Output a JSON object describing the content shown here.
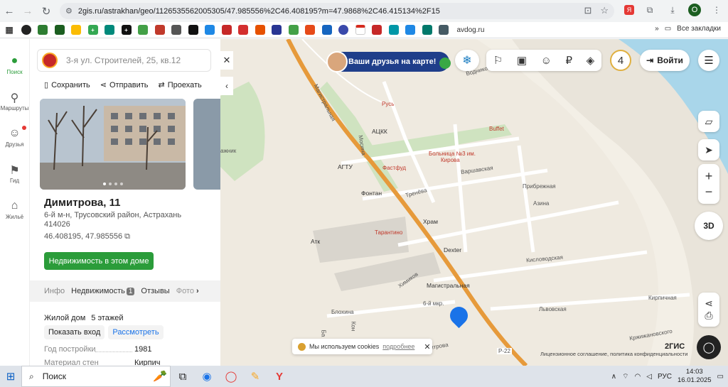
{
  "browser": {
    "url": "2gis.ru/astrakhan/geo/1126535562005305/47.985556%2C46.408195?m=47.9868%2C46.415134%2F15",
    "bookmark_avdog": "avdog.ru",
    "bookmark_all": "Все закладки",
    "profile_letter": "O"
  },
  "rail": {
    "search": "Поиск",
    "routes": "Маршруты",
    "friends": "Друзья",
    "guide": "Гид",
    "housing": "Жильё"
  },
  "panel": {
    "search_placeholder": "3-я ул. Строителей, 25, кв.12",
    "save": "Сохранить",
    "share": "Отправить",
    "route": "Проехать",
    "title": "Димитрова, 11",
    "address_line1": "6-й м-н, Трусовский район, Астрахань",
    "address_line2": "414026",
    "coordinates": "46.408195, 47.985556",
    "realty_button": "Недвижимость в этом доме",
    "tabs": {
      "info": "Инфо",
      "realty": "Недвижимость",
      "realty_count": "1",
      "reviews": "Отзывы",
      "photos": "Фото"
    },
    "building_type": "Жилой дом",
    "floors": "5 этажей",
    "show_entrance": "Показать вход",
    "view": "Рассмотреть",
    "year_label": "Год постройки",
    "year_value": "1981",
    "material_label": "Материал стен",
    "material_value": "Кирпич"
  },
  "map": {
    "promo_text": "Ваши друзья на карте!",
    "friends_count": "4",
    "login": "Войти",
    "zoom_in": "+",
    "zoom_out": "−",
    "btn_3d": "3D",
    "cookie_text": "Мы используем cookies",
    "cookie_link": "подробнее",
    "brand": "2ГИС",
    "license": "Лицензионное соглашение, политика конфиденциальности",
    "labels": {
      "magistralnaya": "Магистральная",
      "mosina": "Мосина",
      "rus": "Русь",
      "atsk": "АЦКК",
      "buffet": "Buffet",
      "hospital1": "Больница №3 им.",
      "hospital2": "Кирова",
      "agtu": "АГТУ",
      "fastfood": "Фастфуд",
      "varshavskaya": "Варшавская",
      "fontan": "Фонтан",
      "treneva": "Тренёва",
      "pribrezhnaya": "Прибрежная",
      "azina": "Азина",
      "hram": "Храм",
      "tarantino": "Тарантино",
      "atk": "Атк",
      "dexter": "Dexter",
      "kislovodskaya": "Кисловодская",
      "himikov": "Химиков",
      "magistralnaya_stop": "Магистральная",
      "blohina": "Блохина",
      "micro6": "6-й мкр.",
      "lvovskaya": "Львовская",
      "kirpichnaya": "Кирпичная",
      "krzhizhanovskogo": "Кржижановского",
      "dimitrova": "итрова",
      "r22": "Р-22",
      "vodnikov": "Водников",
      "kon": "Кон",
      "ba": "Ба",
      "mazhnik": "ажник"
    }
  },
  "taskbar": {
    "search": "Поиск",
    "lang": "РУС",
    "time": "14:03",
    "date": "16.01.2025"
  },
  "colors": {
    "accent_green": "#2b9c3a",
    "river": "#a9d6ea",
    "road_orange": "#e69a3b"
  }
}
